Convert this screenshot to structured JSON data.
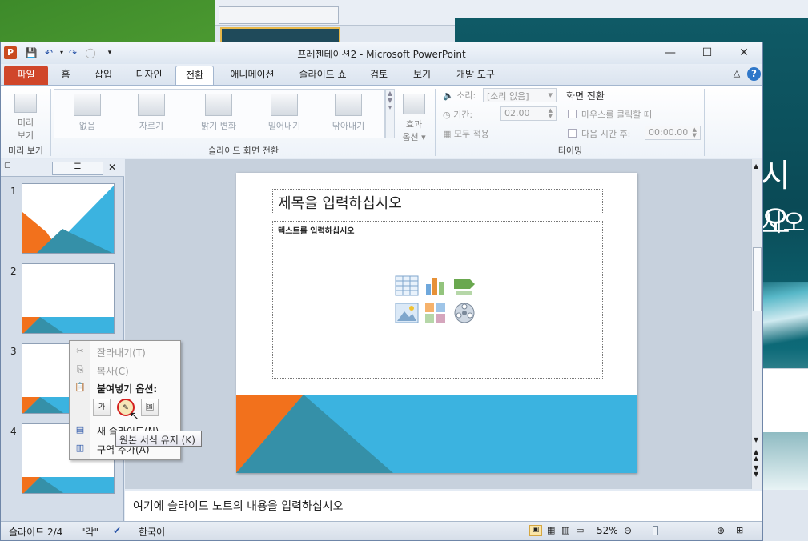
{
  "window": {
    "title": "프레젠테이션2  -  Microsoft PowerPoint",
    "controls": {
      "minimize": "—",
      "maximize": "☐",
      "close": "✕"
    }
  },
  "ribbon_tabs": [
    {
      "label": "파일"
    },
    {
      "label": "홈"
    },
    {
      "label": "삽입"
    },
    {
      "label": "디자인"
    },
    {
      "label": "전환"
    },
    {
      "label": "애니메이션"
    },
    {
      "label": "슬라이드 쇼"
    },
    {
      "label": "검토"
    },
    {
      "label": "보기"
    },
    {
      "label": "개발 도구"
    }
  ],
  "ribbon": {
    "preview": {
      "label_line1": "미리",
      "label_line2": "보기",
      "group": "미리 보기"
    },
    "transitions": [
      {
        "label": "없음"
      },
      {
        "label": "자르기"
      },
      {
        "label": "밝기 변화"
      },
      {
        "label": "밀어내기"
      },
      {
        "label": "닦아내기"
      }
    ],
    "effect_options": {
      "line1": "효과",
      "line2": "옵션 ▾"
    },
    "transition_group": "슬라이드 화면 전환",
    "timing": {
      "sound_label": "소리:",
      "sound_value": "[소리 없음]",
      "duration_label": "기간:",
      "duration_value": "02.00",
      "apply_all": "모두 적용",
      "advance_title": "화면 전환",
      "on_click": "마우스를 클릭할 때",
      "after": "다음 시간 후:",
      "after_value": "00:00.00",
      "group": "타이밍"
    }
  },
  "slides": [
    {
      "num": "1"
    },
    {
      "num": "2"
    },
    {
      "num": "3"
    },
    {
      "num": "4"
    }
  ],
  "slide": {
    "title_placeholder": "제목을 입력하십시오",
    "body_placeholder": "텍스트를 입력하십시오"
  },
  "context_menu": {
    "cut": "잘라내기(T)",
    "copy": "복사(C)",
    "paste_options": "붙여넣기 옵션:",
    "new_slide": "새 슬라이드(N)",
    "section": "구역 추가(A)",
    "tooltip": "원본 서식 유지 (K)"
  },
  "notes": {
    "placeholder": "여기에 슬라이드 노트의 내용을 입력하십시오"
  },
  "statusbar": {
    "slide_info": "슬라이드 2/4",
    "theme": "\"각\"",
    "language": "한국어",
    "zoom": "52%"
  },
  "background": {
    "title_fragment": "시오",
    "subtitle_fragment": "시오"
  },
  "colors": {
    "orange": "#f2711c",
    "blue": "#3bb3e0",
    "teal": "#3590a8",
    "file_tab": "#d0462a"
  }
}
